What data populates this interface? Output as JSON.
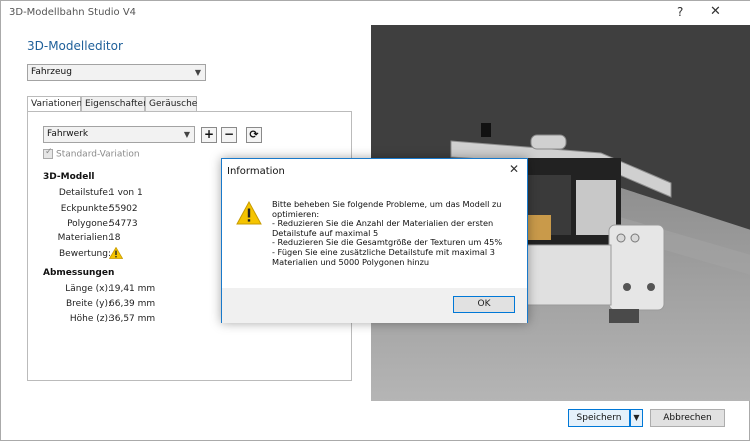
{
  "window": {
    "title": "3D-Modellbahn Studio V4",
    "help_glyph": "?",
    "close_glyph": "✕"
  },
  "editor": {
    "heading": "3D-Modelleditor",
    "type_select": "Fahrzeug",
    "tabs": [
      {
        "label": "Variationen",
        "active": true
      },
      {
        "label": "Eigenschaften",
        "active": false
      },
      {
        "label": "Geräusche",
        "active": false
      }
    ],
    "variation_select": "Fahrwerk",
    "add_label": "+",
    "remove_label": "−",
    "refresh_glyph": "⟳",
    "standard_variation_label": "Standard-Variation",
    "model_section": {
      "heading": "3D-Modell",
      "rows": [
        {
          "label": "Detailstufe:",
          "value": "1 von 1"
        },
        {
          "label": "Eckpunkte:",
          "value": "55902"
        },
        {
          "label": "Polygone:",
          "value": "54773"
        },
        {
          "label": "Materialien:",
          "value": "18"
        },
        {
          "label": "Bewertung:",
          "value": ""
        }
      ]
    },
    "dimensions_section": {
      "heading": "Abmessungen",
      "rows": [
        {
          "label": "Länge (x):",
          "value": "19,41 mm"
        },
        {
          "label": "Breite (y):",
          "value": "66,39 mm"
        },
        {
          "label": "Höhe (z):",
          "value": "36,57 mm"
        }
      ]
    }
  },
  "footer": {
    "save_label": "Speichern",
    "cancel_label": "Abbrechen"
  },
  "dialog": {
    "title": "Information",
    "close_glyph": "✕",
    "message": "Bitte beheben Sie folgende Probleme, um das Modell zu optimieren:\n- Reduzieren Sie die Anzahl der Materialien der ersten Detailstufe auf maximal 5\n- Reduzieren Sie die Gesamtgröße der Texturen um 45%\n- Fügen Sie eine zusätzliche Detailstufe mit maximal 3 Materialien und 5000 Polygonen hinzu",
    "ok_label": "OK"
  },
  "colors": {
    "accent": "#0078d7",
    "heading": "#1e5f99",
    "warning": "#f5c400",
    "viewport_bg": "#404040"
  }
}
